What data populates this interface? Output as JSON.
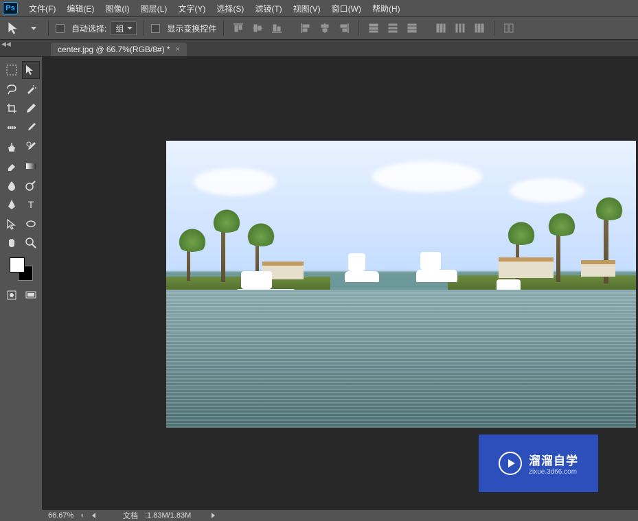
{
  "app": {
    "logo": "Ps"
  },
  "menu": {
    "file": "文件(F)",
    "edit": "编辑(E)",
    "image": "图像(I)",
    "layer": "图层(L)",
    "type": "文字(Y)",
    "select": "选择(S)",
    "filter": "滤镜(T)",
    "view": "视图(V)",
    "window": "窗口(W)",
    "help": "帮助(H)"
  },
  "options": {
    "auto_select_label": "自动选择:",
    "auto_select_value": "组",
    "show_transform_label": "显示变换控件"
  },
  "tab": {
    "title": "center.jpg @ 66.7%(RGB/8#) *",
    "close": "×"
  },
  "status": {
    "zoom": "66.67%",
    "doc_label": "文档",
    "doc_value": "1.83M/1.83M"
  },
  "watermark": {
    "cn": "溜溜自学",
    "en": "zixue.3d66.com"
  },
  "colors": {
    "fg": "#ffffff",
    "bg": "#000000",
    "accent": "#2d4fbb"
  },
  "tools": {
    "col_a": [
      "marquee",
      "lasso",
      "crop",
      "healing",
      "clone",
      "eraser",
      "blur",
      "pen",
      "path-select",
      "hand"
    ],
    "col_b": [
      "move",
      "magic-wand",
      "eyedropper",
      "brush",
      "history-brush",
      "gradient",
      "dodge",
      "type",
      "shape",
      "zoom"
    ],
    "bottom": [
      "quick-mask",
      "screen-mode"
    ]
  }
}
